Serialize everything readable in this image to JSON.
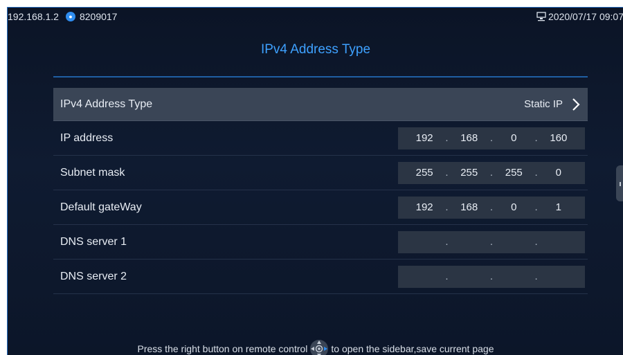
{
  "status_bar": {
    "ip": "192.168.1.2",
    "account": "8209017",
    "datetime": "2020/07/17 09:07",
    "user_icon": "user-icon",
    "network_icon": "network-icon"
  },
  "page": {
    "title": "IPv4 Address Type"
  },
  "rows": {
    "address_type": {
      "label": "IPv4 Address Type",
      "value": "Static IP",
      "icon": "chevron-right-icon"
    },
    "ip_address": {
      "label": "IP address",
      "octets": [
        "192",
        "168",
        "0",
        "160"
      ]
    },
    "subnet_mask": {
      "label": "Subnet mask",
      "octets": [
        "255",
        "255",
        "255",
        "0"
      ]
    },
    "gateway": {
      "label": "Default gateWay",
      "octets": [
        "192",
        "168",
        "0",
        "1"
      ]
    },
    "dns1": {
      "label": "DNS server 1",
      "octets": [
        "",
        "",
        "",
        ""
      ]
    },
    "dns2": {
      "label": "DNS server 2",
      "octets": [
        "",
        "",
        "",
        ""
      ]
    }
  },
  "hint": {
    "before": "Press the right button on remote control",
    "after": "to open the sidebar,save current page",
    "icon": "remote-dpad-icon"
  },
  "colors": {
    "accent": "#3ea1ff",
    "background": "#0f1b31",
    "selected_row": "#3a4556",
    "field": "#2b3544"
  }
}
